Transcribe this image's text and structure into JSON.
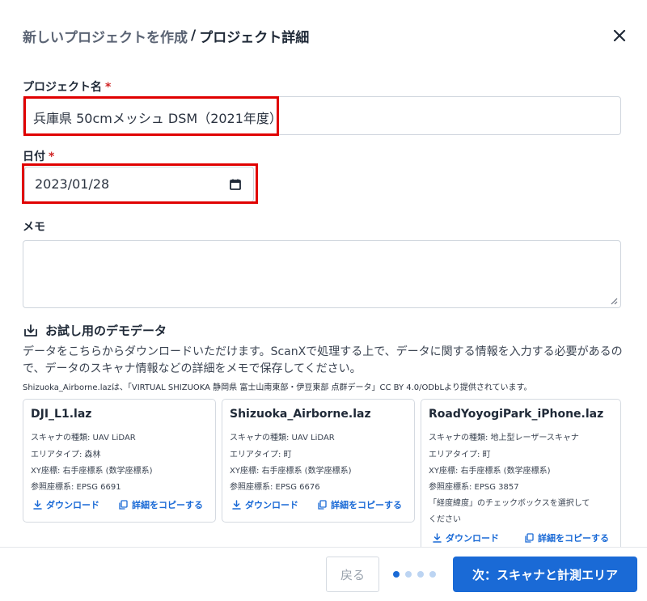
{
  "header": {
    "title_prefix": "新しいプロジェクトを作成",
    "separator": "/",
    "title_current": "プロジェクト詳細"
  },
  "form": {
    "project_name": {
      "label": "プロジェクト名",
      "required_mark": "*",
      "value": "兵庫県 50cmメッシュ DSM（2021年度）"
    },
    "date": {
      "label": "日付",
      "required_mark": "*",
      "value": "2023/01/28"
    },
    "memo": {
      "label": "メモ",
      "value": ""
    }
  },
  "demo": {
    "title": "お試し用のデモデータ",
    "description": "データをこちらからダウンロードいただけます。ScanXで処理する上で、データに関する情報を入力する必要があるので、データのスキャナ情報などの詳細をメモで保存してください。",
    "attribution": "Shizuoka_Airborne.lazは、「VIRTUAL SHIZUOKA 静岡県 富士山南東部・伊豆東部 点群データ」CC BY 4.0/ODbLより提供されています。",
    "download_label": "ダウンロード",
    "copy_label": "詳細をコピーする",
    "cards": [
      {
        "name": "DJI_L1.laz",
        "lines": [
          "スキャナの種類: UAV LiDAR",
          "エリアタイプ: 森林",
          "XY座標: 右手座標系 (数学座標系)",
          "参照座標系: EPSG 6691"
        ]
      },
      {
        "name": "Shizuoka_Airborne.laz",
        "lines": [
          "スキャナの種類: UAV LiDAR",
          "エリアタイプ: 町",
          "XY座標: 右手座標系 (数学座標系)",
          "参照座標系: EPSG 6676"
        ]
      },
      {
        "name": "RoadYoyogiPark_iPhone.laz",
        "lines": [
          "スキャナの種類: 地上型レーザースキャナ",
          "エリアタイプ: 町",
          "XY座標: 右手座標系 (数学座標系)",
          "参照座標系: EPSG 3857",
          "「経度緯度」のチェックボックスを選択して",
          "ください"
        ]
      }
    ]
  },
  "footer": {
    "back_label": "戻る",
    "next_label": "次：スキャナと計測エリア",
    "steps_total": 4,
    "step_current": 1
  },
  "colors": {
    "accent": "#1a6ad6",
    "required": "#d02525",
    "highlight": "#e00000"
  }
}
